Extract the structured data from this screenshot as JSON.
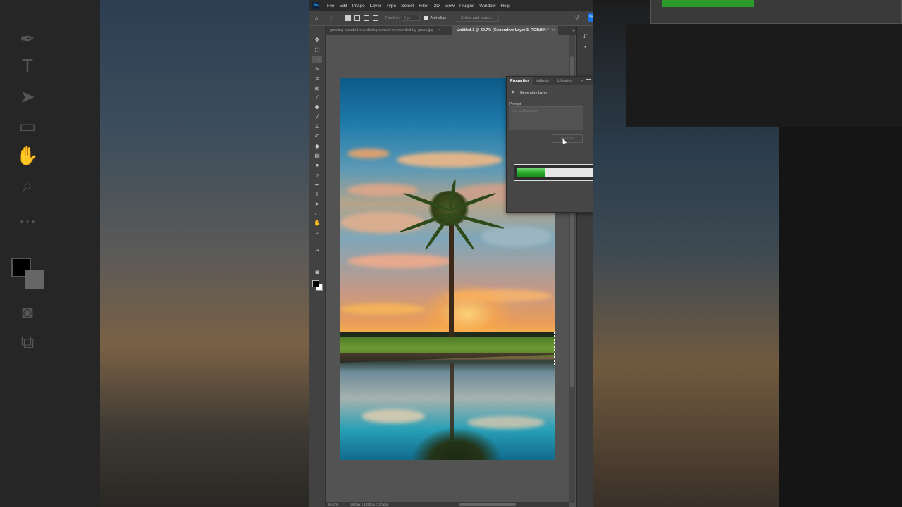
{
  "menubar": {
    "app_logo": "Ps",
    "items": [
      "File",
      "Edit",
      "Image",
      "Layer",
      "Type",
      "Select",
      "Filter",
      "3D",
      "View",
      "Plugins",
      "Window",
      "Help"
    ]
  },
  "options_bar": {
    "feather_label": "Feather:",
    "feather_value": "0 px",
    "antialias_label": "Anti-alias",
    "select_mask_label": "Select and Mask...",
    "share_label": "Sh"
  },
  "tabs": [
    {
      "label": "growing-clouded-sky-during-sunset-surrounded-by-grass.jpg",
      "active": false
    },
    {
      "label": "Untitled-1 @ 80.7% (Generative Layer 3, RGB/8#) *",
      "active": true
    }
  ],
  "tab_close_glyph": "×",
  "properties_panel": {
    "tabs": [
      "Properties",
      "Adjustm",
      "Libraries"
    ],
    "layer_type": "Generative Layer",
    "prompt_label": "Prompt:",
    "prompt_placeholder": "Add and the beach",
    "generate_button": "Generate"
  },
  "progress": {
    "percent": 0.36,
    "fill_color": "#26a626"
  },
  "status_bar": {
    "zoom": "80.67%",
    "doc_info": "1080 px x 1920 px (120 ppi)"
  },
  "icons": [
    "home-icon",
    "lasso-icon",
    "move-tool-icon",
    "artboard-icon",
    "lasso-tool-icon",
    "quick-select-icon",
    "crop-icon",
    "frame-icon",
    "eyedropper-icon",
    "healing-brush-icon",
    "brush-icon",
    "stamp-icon",
    "history-brush-icon",
    "eraser-icon",
    "gradient-icon",
    "blur-icon",
    "dodge-icon",
    "pen-icon",
    "type-icon",
    "path-select-icon",
    "rectangle-icon",
    "hand-icon",
    "zoom-icon",
    "more-tools-icon",
    "quick-mask-icon",
    "screen-mode-icon"
  ]
}
